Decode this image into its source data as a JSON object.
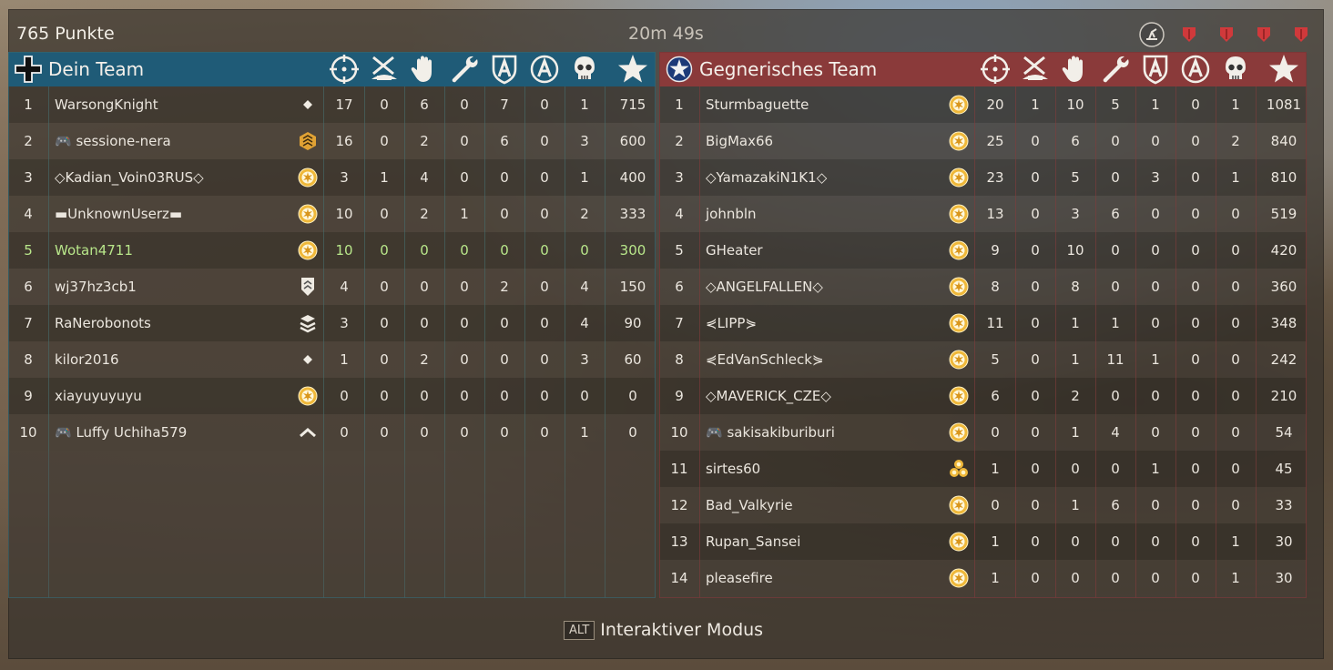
{
  "header": {
    "score": "765 Punkte",
    "timer": "20m 49s"
  },
  "alt_hint": {
    "key": "ALT",
    "label": "Interaktiver Modus"
  },
  "colors": {
    "own": "#1f5b77",
    "enemy": "#8a3a3a",
    "highlight": "#b8e68a"
  },
  "stat_icons": [
    "crosshair-icon",
    "anti-tank-icon",
    "hand-icon",
    "wrench-icon",
    "shield-a-icon",
    "circle-a-icon",
    "skull-icon",
    "star-icon"
  ],
  "teams": [
    {
      "id": "own",
      "title": "Dein Team",
      "players": [
        {
          "n": "1",
          "name": "WarsongKnight",
          "rank": "small",
          "s": [
            "17",
            "0",
            "6",
            "0",
            "7",
            "0",
            "1",
            "715"
          ]
        },
        {
          "n": "2",
          "name": "🎮 sessione-nera",
          "rank": "chev",
          "s": [
            "16",
            "0",
            "2",
            "0",
            "6",
            "0",
            "3",
            "600"
          ]
        },
        {
          "n": "3",
          "name": "◇Kadian_Voin03RUS◇",
          "rank": "sun",
          "s": [
            "3",
            "1",
            "4",
            "0",
            "0",
            "0",
            "1",
            "400"
          ]
        },
        {
          "n": "4",
          "name": "▬UnknownUserz▬",
          "rank": "sun",
          "s": [
            "10",
            "0",
            "2",
            "1",
            "0",
            "0",
            "2",
            "333"
          ]
        },
        {
          "n": "5",
          "name": "Wotan4711",
          "rank": "sun",
          "me": true,
          "s": [
            "10",
            "0",
            "0",
            "0",
            "0",
            "0",
            "0",
            "300"
          ]
        },
        {
          "n": "6",
          "name": "wj37hz3cb1",
          "rank": "shield",
          "s": [
            "4",
            "0",
            "0",
            "0",
            "2",
            "0",
            "4",
            "150"
          ]
        },
        {
          "n": "7",
          "name": "RaNerobonots",
          "rank": "layers",
          "s": [
            "3",
            "0",
            "0",
            "0",
            "0",
            "0",
            "4",
            "90"
          ]
        },
        {
          "n": "8",
          "name": "kilor2016",
          "rank": "small",
          "s": [
            "1",
            "0",
            "2",
            "0",
            "0",
            "0",
            "3",
            "60"
          ]
        },
        {
          "n": "9",
          "name": "xiayuyuyuyu",
          "rank": "sun",
          "s": [
            "0",
            "0",
            "0",
            "0",
            "0",
            "0",
            "0",
            "0"
          ]
        },
        {
          "n": "10",
          "name": "🎮 Luffy Uchiha579",
          "rank": "caret",
          "s": [
            "0",
            "0",
            "0",
            "0",
            "0",
            "0",
            "1",
            "0"
          ]
        }
      ]
    },
    {
      "id": "enemy",
      "title": "Gegnerisches Team",
      "players": [
        {
          "n": "1",
          "name": "Sturmbaguette",
          "rank": "sun",
          "s": [
            "20",
            "1",
            "10",
            "5",
            "1",
            "0",
            "1",
            "1081"
          ]
        },
        {
          "n": "2",
          "name": "BigMax66",
          "rank": "sun",
          "s": [
            "25",
            "0",
            "6",
            "0",
            "0",
            "0",
            "2",
            "840"
          ]
        },
        {
          "n": "3",
          "name": "◇YamazakiN1K1◇",
          "rank": "sun",
          "s": [
            "23",
            "0",
            "5",
            "0",
            "3",
            "0",
            "1",
            "810"
          ]
        },
        {
          "n": "4",
          "name": "johnbln",
          "rank": "sun",
          "s": [
            "13",
            "0",
            "3",
            "6",
            "0",
            "0",
            "0",
            "519"
          ]
        },
        {
          "n": "5",
          "name": "GHeater",
          "rank": "sun",
          "s": [
            "9",
            "0",
            "10",
            "0",
            "0",
            "0",
            "0",
            "420"
          ]
        },
        {
          "n": "6",
          "name": "◇ANGELFALLEN◇",
          "rank": "sun",
          "s": [
            "8",
            "0",
            "8",
            "0",
            "0",
            "0",
            "0",
            "360"
          ]
        },
        {
          "n": "7",
          "name": "⋞LIPP⋟",
          "rank": "sun",
          "s": [
            "11",
            "0",
            "1",
            "1",
            "0",
            "0",
            "0",
            "348"
          ]
        },
        {
          "n": "8",
          "name": "⋞EdVanSchleck⋟",
          "rank": "sun",
          "s": [
            "5",
            "0",
            "1",
            "11",
            "1",
            "0",
            "0",
            "242"
          ]
        },
        {
          "n": "9",
          "name": "◇MAVERICK_CZE◇",
          "rank": "sun",
          "s": [
            "6",
            "0",
            "2",
            "0",
            "0",
            "0",
            "0",
            "210"
          ]
        },
        {
          "n": "10",
          "name": "🎮 sakisakiburiburi",
          "rank": "sun",
          "s": [
            "0",
            "0",
            "1",
            "4",
            "0",
            "0",
            "0",
            "54"
          ]
        },
        {
          "n": "11",
          "name": "sirtes60",
          "rank": "multi",
          "s": [
            "1",
            "0",
            "0",
            "0",
            "1",
            "0",
            "0",
            "45"
          ]
        },
        {
          "n": "12",
          "name": "Bad_Valkyrie",
          "rank": "sun",
          "s": [
            "0",
            "0",
            "1",
            "6",
            "0",
            "0",
            "0",
            "33"
          ]
        },
        {
          "n": "13",
          "name": "Rupan_Sansei",
          "rank": "sun",
          "s": [
            "1",
            "0",
            "0",
            "0",
            "0",
            "0",
            "1",
            "30"
          ]
        },
        {
          "n": "14",
          "name": "pleasefire",
          "rank": "sun",
          "s": [
            "1",
            "0",
            "0",
            "0",
            "0",
            "0",
            "1",
            "30"
          ]
        }
      ]
    }
  ]
}
